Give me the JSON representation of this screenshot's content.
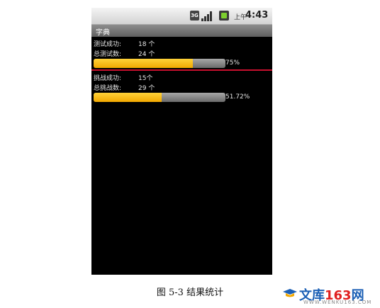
{
  "status_bar": {
    "ampm": "上午",
    "time": "4:43",
    "network": "3G"
  },
  "app": {
    "title": "字典"
  },
  "test_stats": {
    "success_label": "测试成功:",
    "success_value": "18 个",
    "total_label": "总测试数:",
    "total_value": "24 个",
    "progress": 0.75,
    "percent_text": "75%"
  },
  "challenge_stats": {
    "success_label": "挑战成功:",
    "success_value": "15个",
    "total_label": "总挑战数:",
    "total_value": "29 个",
    "progress": 0.5172,
    "percent_text": "51.72%"
  },
  "caption": "图 5-3  结果统计",
  "watermark": {
    "brand_cn1": "文库",
    "brand_num": "163",
    "brand_cn2": "网",
    "url": "WWW.WENKU163.COM"
  },
  "colors": {
    "progress_fill": "#f6b400",
    "progress_track": "#8a8a8a",
    "divider": "#c8102e",
    "screen": "#000000"
  }
}
